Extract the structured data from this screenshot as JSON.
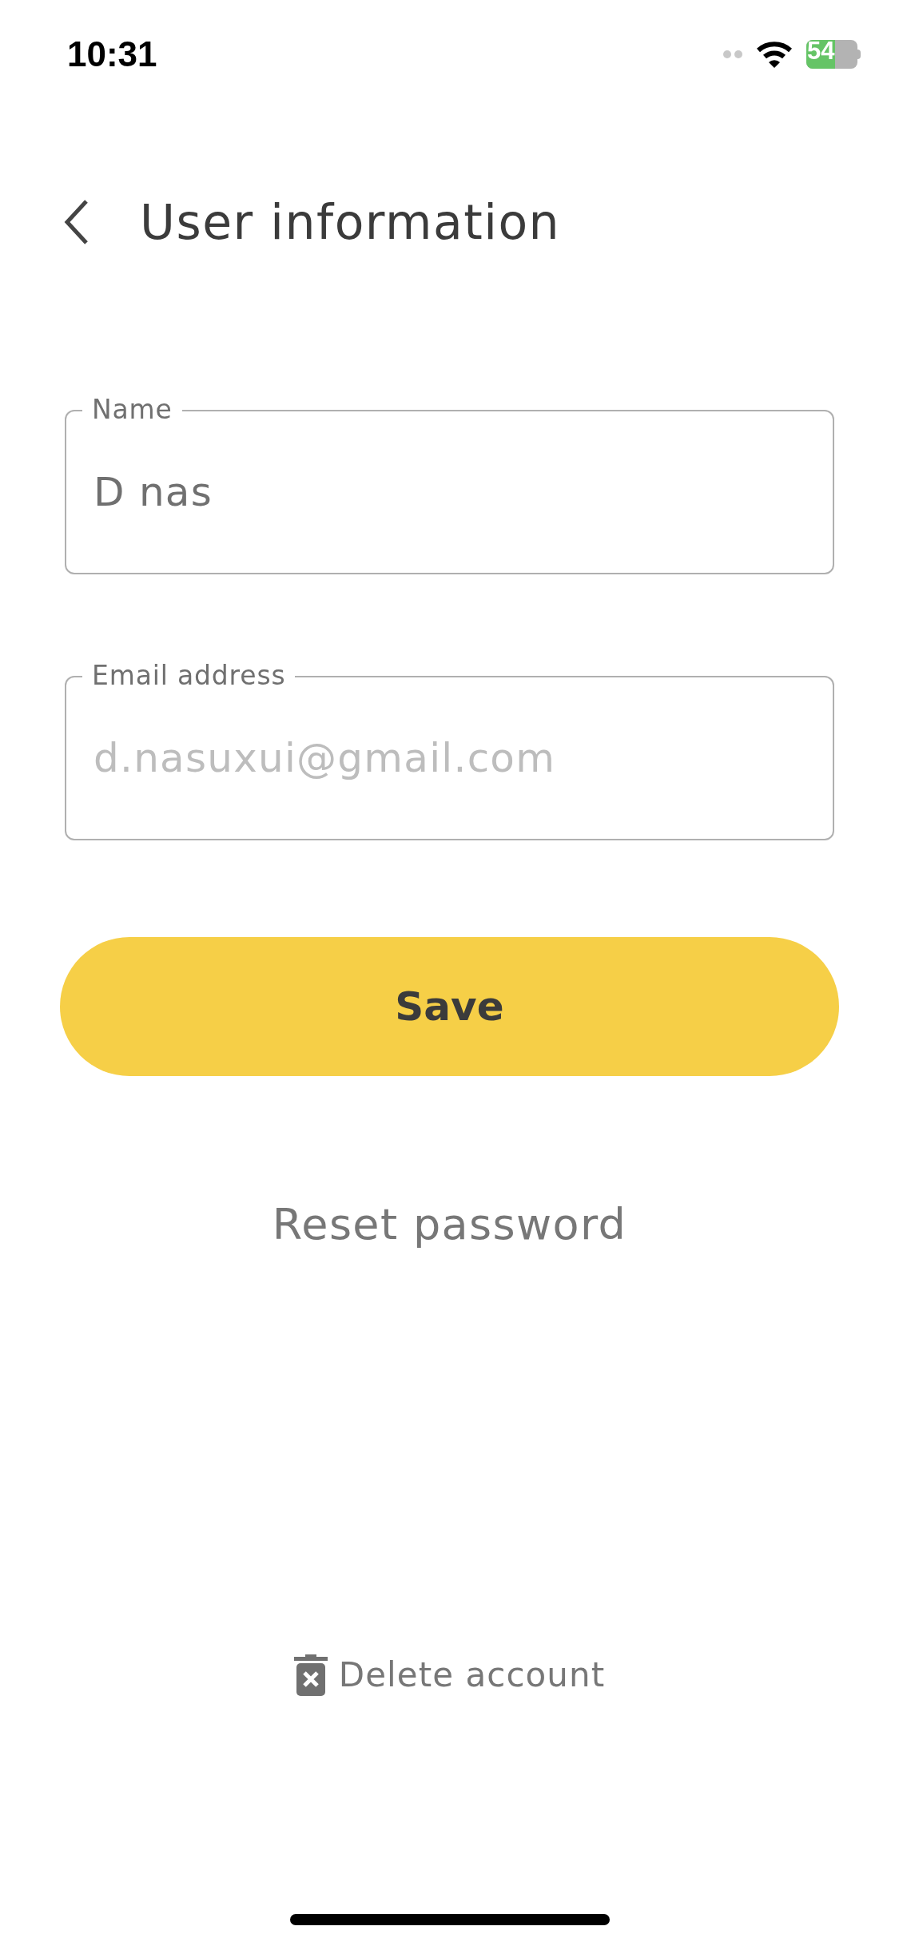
{
  "status_bar": {
    "time": "10:31",
    "battery": "54"
  },
  "header": {
    "title": "User information"
  },
  "fields": [
    {
      "label": "Name",
      "value": "D nas"
    },
    {
      "label": "Email address",
      "placeholder": "d.nasuxui@gmail.com"
    }
  ],
  "save_button": "Save",
  "reset_link": "Reset password",
  "delete_link": "Delete account"
}
